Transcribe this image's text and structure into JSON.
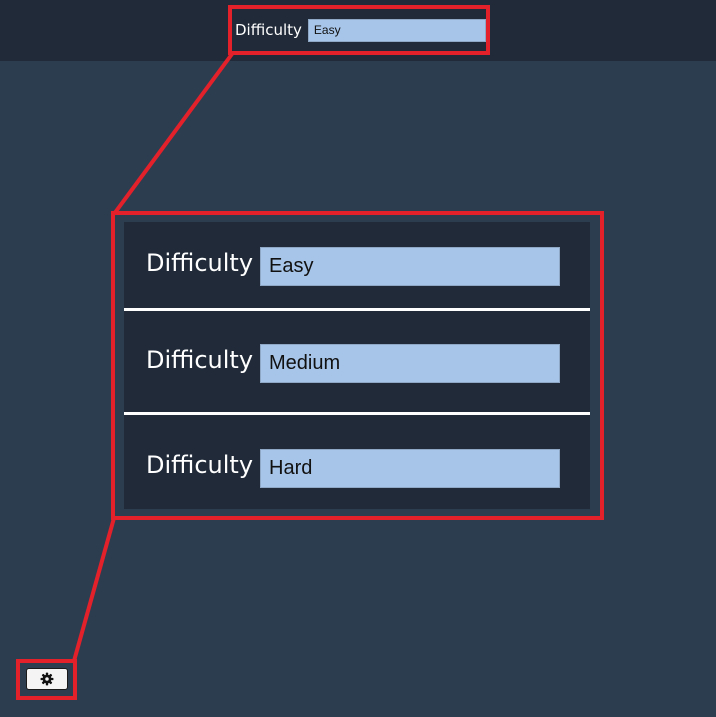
{
  "topbar": {
    "difficulty_label": "Difficulty",
    "difficulty_value": "Easy"
  },
  "zoom_panel": {
    "options": [
      {
        "label": "Difficulty",
        "value": "Easy"
      },
      {
        "label": "Difficulty",
        "value": "Medium"
      },
      {
        "label": "Difficulty",
        "value": "Hard"
      }
    ]
  },
  "settings_button": {
    "icon": "gear-icon"
  },
  "colors": {
    "background": "#2d3d50",
    "bar": "#202a38",
    "field": "#a7c5e8",
    "highlight": "#e3212b"
  }
}
